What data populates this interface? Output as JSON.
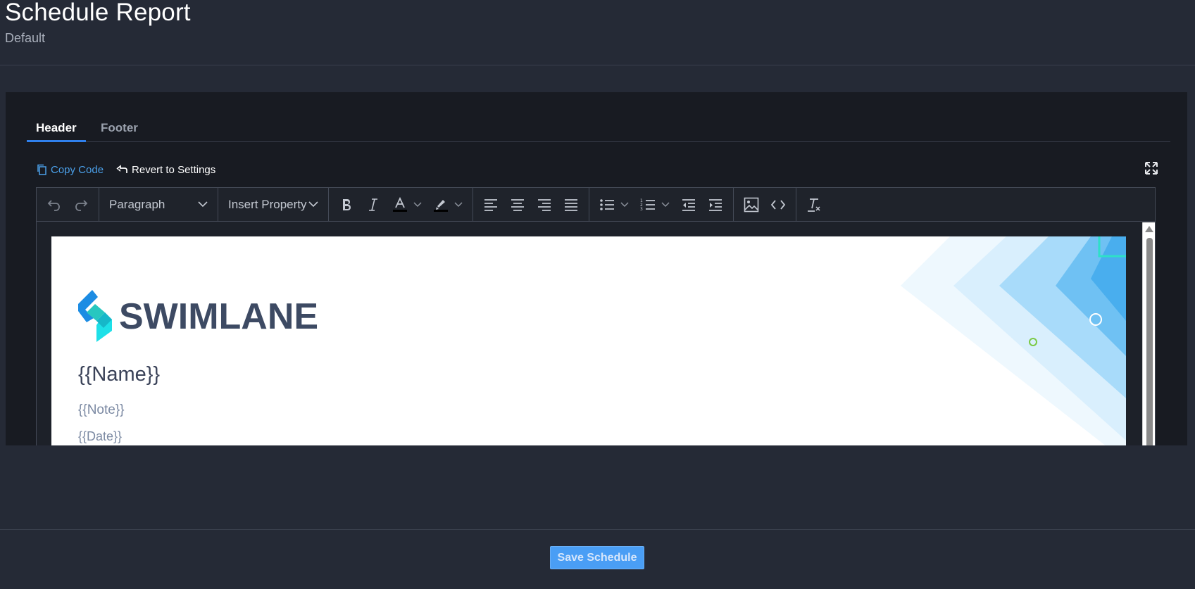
{
  "page": {
    "title": "Schedule Report",
    "subtitle": "Default"
  },
  "tabs": [
    {
      "label": "Header",
      "active": true
    },
    {
      "label": "Footer",
      "active": false
    }
  ],
  "actions": {
    "copy_code": "Copy Code",
    "revert": "Revert to Settings"
  },
  "toolbar": {
    "paragraph": "Paragraph",
    "insert_property": "Insert Property",
    "icons": [
      "undo-icon",
      "redo-icon",
      "bold-icon",
      "italic-icon",
      "text-color-icon",
      "highlight-icon",
      "align-left-icon",
      "align-center-icon",
      "align-right-icon",
      "align-justify-icon",
      "bullet-list-icon",
      "numbered-list-icon",
      "outdent-icon",
      "indent-icon",
      "image-icon",
      "code-icon",
      "clear-format-icon"
    ]
  },
  "document": {
    "logo_text": "SWIMLANE",
    "name": "{{Name}}",
    "note": "{{Note}}",
    "date": "{{Date}}"
  },
  "footer": {
    "save_label": "Save Schedule"
  },
  "colors": {
    "background": "#252a36",
    "panel": "#181b22",
    "accent": "#2f80ed",
    "button": "#4a9ef5",
    "logo_text": "#3d4a63"
  }
}
